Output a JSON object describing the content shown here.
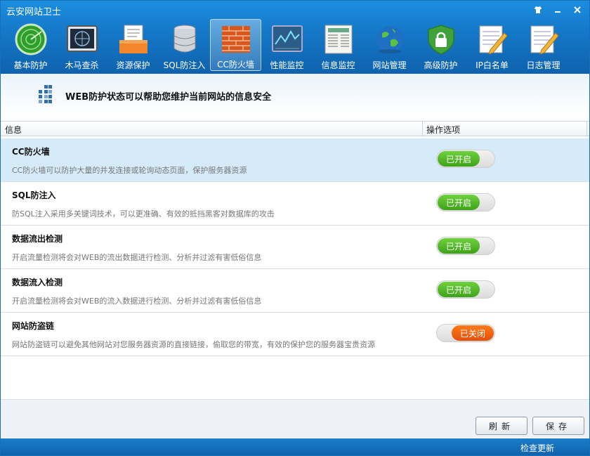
{
  "window": {
    "title": "云安网站卫士"
  },
  "toolbar": {
    "items": [
      {
        "label": "基本防护",
        "icon": "radar-icon"
      },
      {
        "label": "木马查杀",
        "icon": "scan-monitor-icon"
      },
      {
        "label": "资源保护",
        "icon": "document-tray-icon"
      },
      {
        "label": "SQL防注入",
        "icon": "database-icon"
      },
      {
        "label": "CC防火墙",
        "icon": "brick-wall-icon"
      },
      {
        "label": "性能监控",
        "icon": "performance-chart-icon"
      },
      {
        "label": "信息监控",
        "icon": "newspaper-icon"
      },
      {
        "label": "网站管理",
        "icon": "globe-icon"
      },
      {
        "label": "高级防护",
        "icon": "shield-lock-icon"
      },
      {
        "label": "IP白名单",
        "icon": "notepad-pencil-icon"
      },
      {
        "label": "日志管理",
        "icon": "log-pencil-icon"
      }
    ],
    "active_index": 4
  },
  "banner": {
    "text": "WEB防护状态可以帮助您维护当前网站的信息安全"
  },
  "table": {
    "headers": {
      "info": "信息",
      "options": "操作选项"
    },
    "rows": [
      {
        "title": "CC防火墙",
        "desc": "CC防火墙可以防护大量的并发连接或轮询动态页面，保护服务器资源",
        "state": "已开启",
        "on": true
      },
      {
        "title": "SQL防注入",
        "desc": "防SQL注入采用多关键词技术，可以更准确、有效的抵挡黑客对数据库的攻击",
        "state": "已开启",
        "on": true
      },
      {
        "title": "数据流出检测",
        "desc": "开启流量检测将会对WEB的流出数据进行检测、分析并过滤有害低俗信息",
        "state": "已开启",
        "on": true
      },
      {
        "title": "数据流入检测",
        "desc": "开启流量检测将会对WEB的流入数据进行检测、分析并过滤有害低俗信息",
        "state": "已开启",
        "on": true
      },
      {
        "title": "网站防盗链",
        "desc": "网站防盗链可以避免其他网站对您服务器资源的直接链接，偷取您的带宽，有效的保护您的服务器宝贵资源",
        "state": "已关闭",
        "on": false
      }
    ]
  },
  "buttons": {
    "refresh": "刷新",
    "save": "保存"
  },
  "status": {
    "update_link": "检查更新"
  },
  "colors": {
    "title_bar": "#1579c9",
    "switch_on": "#4cb224",
    "switch_off": "#f0600f",
    "selected_row": "#d6ebf9"
  }
}
